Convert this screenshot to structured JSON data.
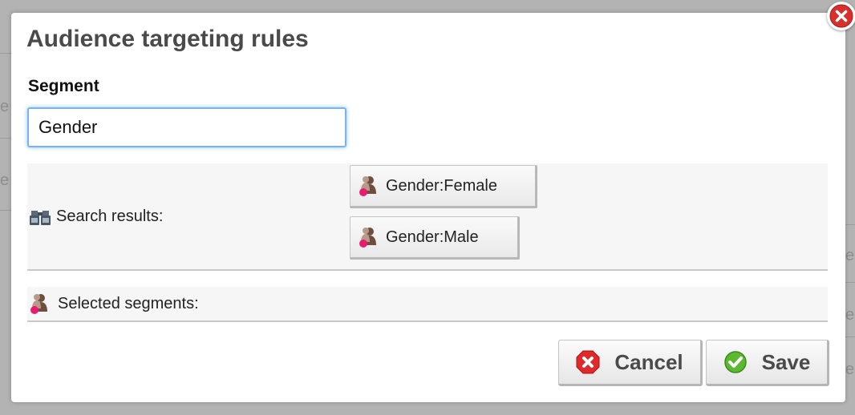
{
  "background": {
    "ghost_chars": [
      "e",
      "e",
      "es",
      "es",
      "es"
    ]
  },
  "dialog": {
    "title": "Audience targeting rules",
    "close_icon": "close-icon"
  },
  "segment": {
    "label": "Segment",
    "input_value": "Gender"
  },
  "search_results": {
    "label": "Search results:",
    "icon": "binoculars-icon",
    "items": [
      {
        "label": "Gender:Female",
        "icon": "segment-icon"
      },
      {
        "label": "Gender:Male",
        "icon": "segment-icon"
      }
    ]
  },
  "selected_segments": {
    "label": "Selected segments:",
    "icon": "segment-icon"
  },
  "actions": {
    "cancel_label": "Cancel",
    "save_label": "Save"
  },
  "colors": {
    "cancel_red": "#e02a2a",
    "save_green": "#5cb82f",
    "focus_blue": "#79b3ea"
  }
}
